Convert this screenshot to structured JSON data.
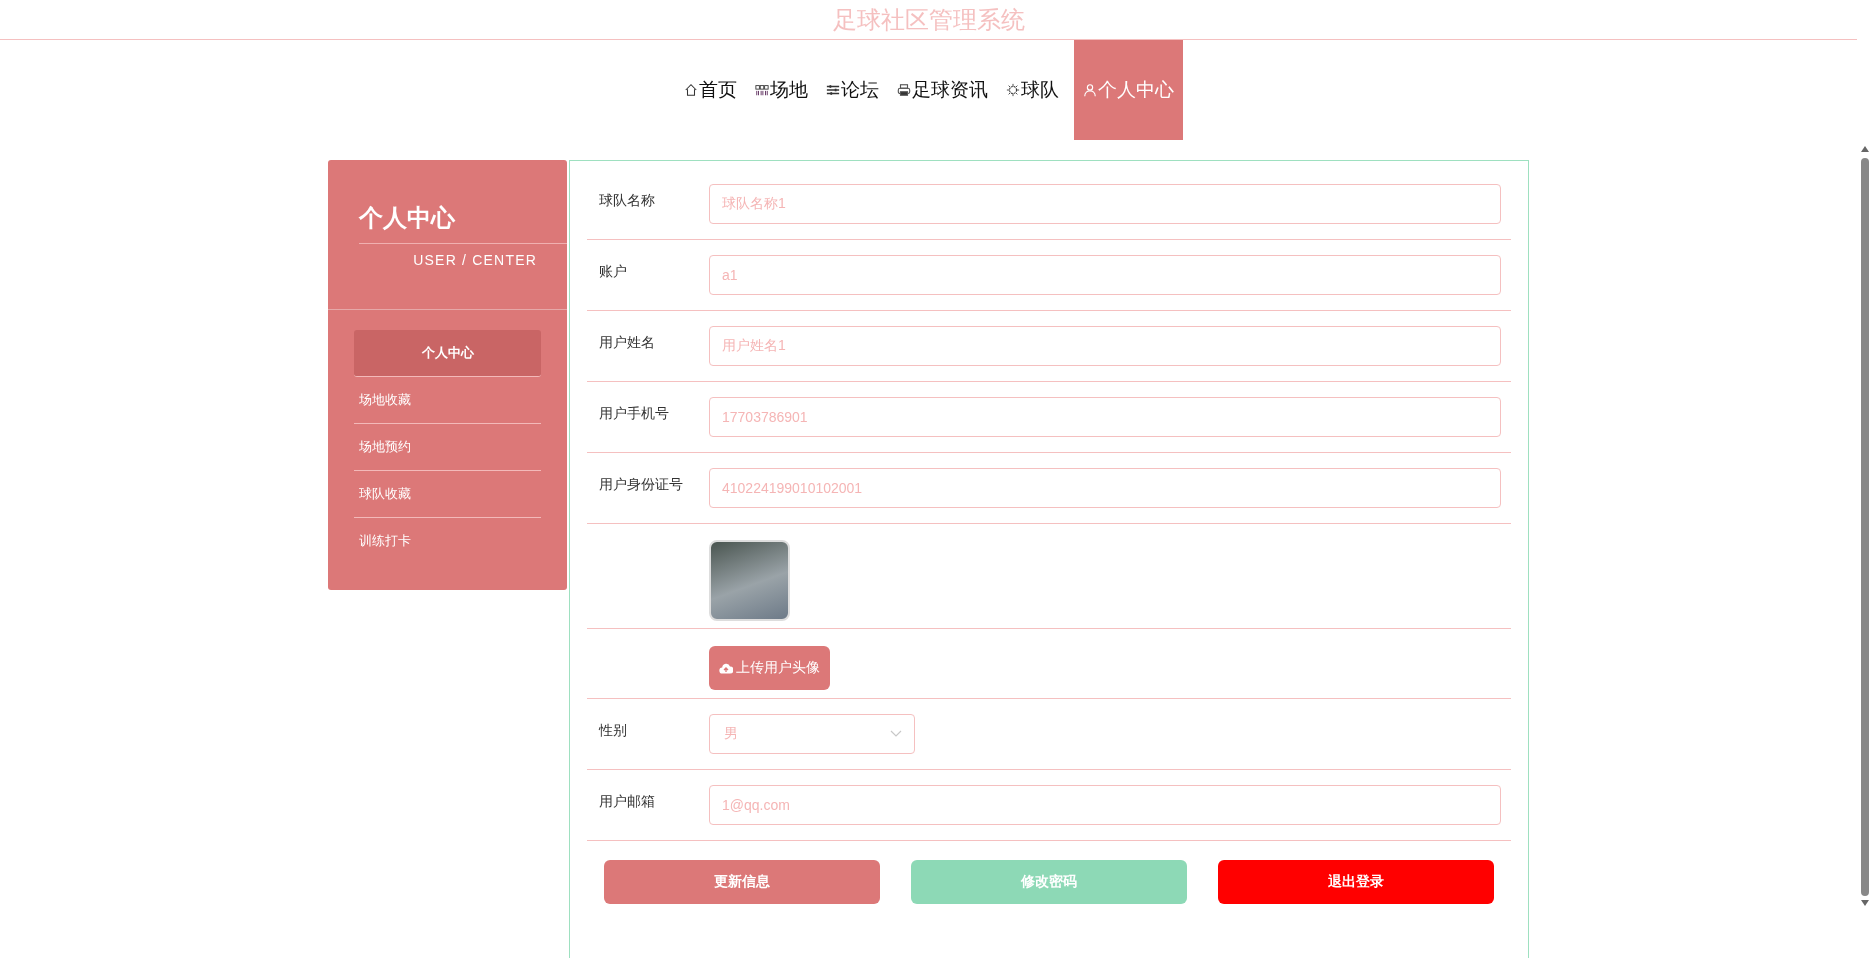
{
  "header": {
    "title": "足球社区管理系统"
  },
  "nav": [
    {
      "label": "首页",
      "selected": false
    },
    {
      "label": "场地",
      "selected": false
    },
    {
      "label": "论坛",
      "selected": false
    },
    {
      "label": "足球资讯",
      "selected": false
    },
    {
      "label": "球队",
      "selected": false
    },
    {
      "label": "个人中心",
      "selected": true
    }
  ],
  "sidebar": {
    "title": "个人中心",
    "subtitle": "USER / CENTER",
    "items": [
      {
        "label": "个人中心",
        "selected": true
      },
      {
        "label": "场地收藏",
        "selected": false
      },
      {
        "label": "场地预约",
        "selected": false
      },
      {
        "label": "球队收藏",
        "selected": false
      },
      {
        "label": "训练打卡",
        "selected": false
      }
    ]
  },
  "form": {
    "fields": [
      {
        "kind": "text",
        "label": "球队名称",
        "value": "球队名称1"
      },
      {
        "kind": "text",
        "label": "账户",
        "value": "a1"
      },
      {
        "kind": "text",
        "label": "用户姓名",
        "value": "用户姓名1"
      },
      {
        "kind": "text",
        "label": "用户手机号",
        "value": "17703786901"
      },
      {
        "kind": "text",
        "label": "用户身份证号",
        "value": "410224199010102001"
      },
      {
        "kind": "avatar"
      },
      {
        "kind": "upload",
        "button": "上传用户头像"
      },
      {
        "kind": "select",
        "label": "性别",
        "value": "男"
      },
      {
        "kind": "text",
        "label": "用户邮箱",
        "value": "1@qq.com"
      }
    ],
    "buttons": [
      {
        "kind": "update",
        "label": "更新信息"
      },
      {
        "kind": "password",
        "label": "修改密码"
      },
      {
        "kind": "logout",
        "label": "退出登录"
      }
    ]
  }
}
